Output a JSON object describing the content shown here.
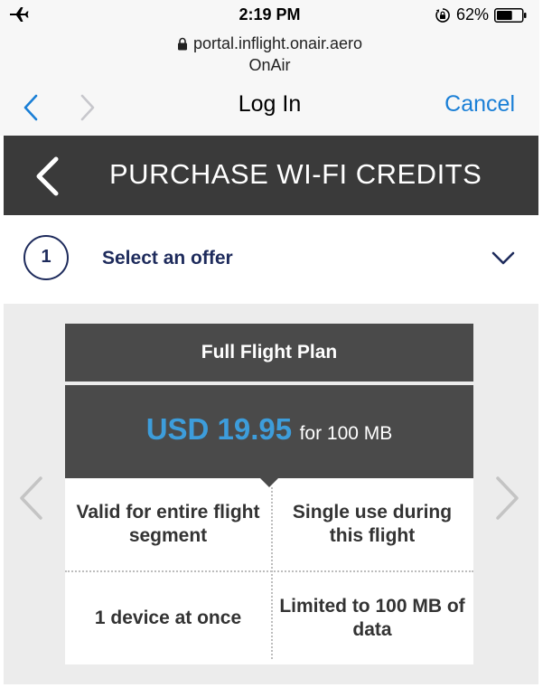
{
  "status_bar": {
    "time": "2:19 PM",
    "battery_percent": "62%",
    "battery_level": 0.62,
    "icons": [
      "airplane-icon",
      "rotation-lock-icon",
      "battery-icon"
    ]
  },
  "browser": {
    "url": "portal.inflight.onair.aero",
    "site_name": "OnAir",
    "nav_title": "Log In",
    "cancel_label": "Cancel",
    "accent_color": "#1a7fd6"
  },
  "header": {
    "title": "PURCHASE WI-FI CREDITS",
    "background_color": "#3a3a3a"
  },
  "step": {
    "number": "1",
    "label": "Select an offer",
    "color": "#1e2b5c"
  },
  "offer": {
    "plan_name": "Full Flight Plan",
    "price": "USD 19.95",
    "price_suffix": "for 100 MB",
    "price_color": "#3d9ddb",
    "features": [
      "Valid for entire flight segment",
      "Single use during this flight",
      "1 device at once",
      "Limited to 100 MB of data"
    ]
  }
}
